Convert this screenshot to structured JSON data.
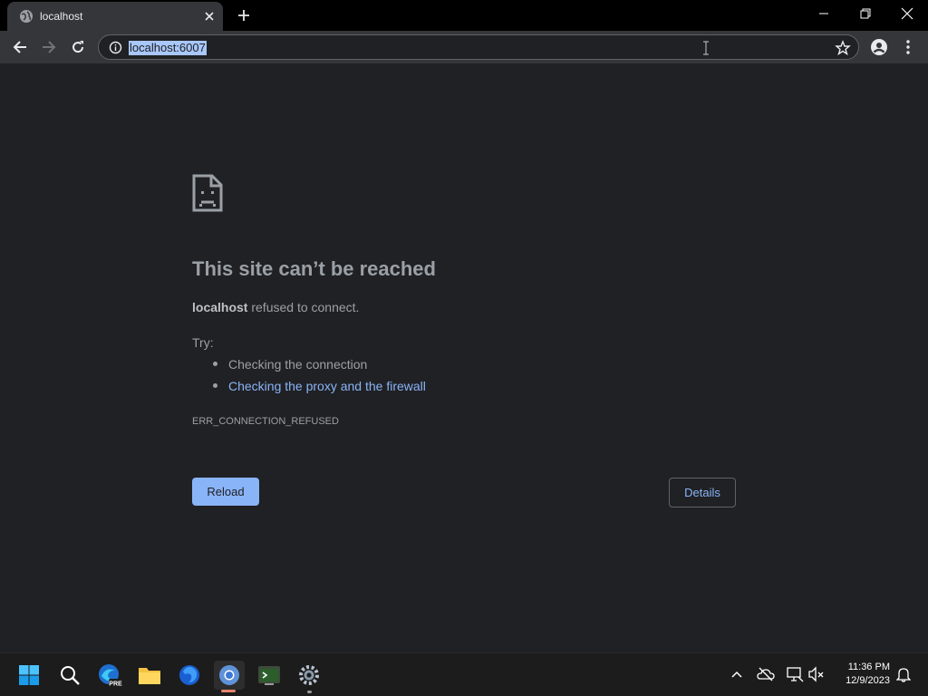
{
  "browser": {
    "tab": {
      "title": "localhost",
      "favicon": "globe-icon"
    },
    "address": {
      "url": "localhost:6007"
    }
  },
  "error_page": {
    "heading": "This site can’t be reached",
    "host": "localhost",
    "description_suffix": " refused to connect.",
    "try_label": "Try:",
    "suggestions": [
      "Checking the connection",
      "Checking the proxy and the firewall"
    ],
    "error_code": "ERR_CONNECTION_REFUSED",
    "reload_label": "Reload",
    "details_label": "Details"
  },
  "taskbar": {
    "apps": [
      "windows-start-icon",
      "search-icon",
      "edge-preview-icon",
      "file-explorer-icon",
      "firefox-icon",
      "chrome-icon",
      "terminal-icon",
      "settings-icon"
    ],
    "clock": {
      "time": "11:36 PM",
      "date": "12/9/2023"
    }
  },
  "colors": {
    "page_bg": "#202124",
    "link": "#8ab4f8",
    "text": "#9aa0a6",
    "url_selection": "#a8c7fa"
  }
}
